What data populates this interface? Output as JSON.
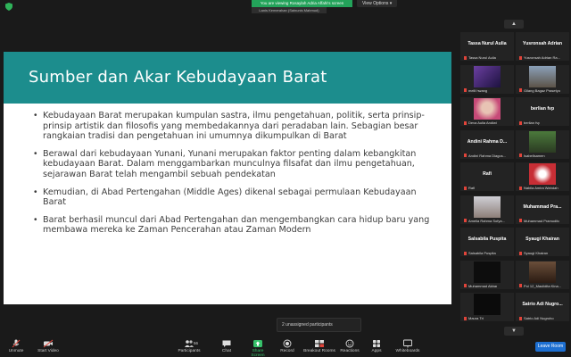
{
  "banner": {
    "viewing_text": "You are viewing Rosaylah Adria Affahi's screen",
    "sub_text": "Lanis Kemerahan (Sainunis Mahmud)",
    "view_options": "View Options"
  },
  "slide": {
    "title": "Sumber dan Akar Kebudayaan Barat",
    "bullets": [
      "Kebudayaan Barat merupakan kumpulan sastra, ilmu pengetahuan, politik, serta prinsip-prinsip artistik dan filosofis yang membedakannya dari peradaban lain. Sebagian besar rangkaian tradisi dan pengetahuan ini umumnya dikumpulkan di Barat",
      "Berawal dari kebudayaan Yunani, Yunani merupakan faktor penting dalam kebangkitan kebudayaan Barat. Dalam menggambarkan munculnya filsafat dan ilmu pengetahuan, sejarawan Barat telah mengambil sebuah pendekatan",
      "Kemudian, di Abad Pertengahan (Middle Ages) dikenal sebagai permulaan Kebudayaan Barat",
      "Barat berhasil muncul dari Abad Pertengahan dan mengembangkan cara hidup baru yang membawa mereka ke Zaman Pencerahan atau Zaman Modern"
    ]
  },
  "popup": {
    "text": "2 unassigned participants"
  },
  "participants": [
    {
      "big": "Tassa Nurul Aulia",
      "small": "Tassa Nurul Aulia",
      "photo": ""
    },
    {
      "big": "Yusronsah Adrian",
      "small": "Yusronsah Adrian Ra...",
      "photo": ""
    },
    {
      "big": "",
      "small": "melli hwang",
      "photo": "purple"
    },
    {
      "big": "",
      "small": "Gilang Bagaz Prasetyo",
      "photo": "street"
    },
    {
      "big": "",
      "small": "Deva Aulia Andiwi",
      "photo": "face"
    },
    {
      "big": "berlian fvp",
      "small": "berlian fvp",
      "photo": ""
    },
    {
      "big": "Andini Rahma D...",
      "small": "Andini Rahma Diagos...",
      "photo": ""
    },
    {
      "big": "",
      "small": "Isabellsamen",
      "photo": "green"
    },
    {
      "big": "Rafi",
      "small": "Rafi",
      "photo": ""
    },
    {
      "big": "",
      "small": "Nabila Amira Wahdah",
      "photo": "red"
    },
    {
      "big": "",
      "small": "Amelia Rahma Sofya...",
      "photo": "room"
    },
    {
      "big": "Muhammad Pra...",
      "small": "Muhammad Pramudito",
      "photo": ""
    },
    {
      "big": "Salsabila Puspita",
      "small": "Salsabila Puspita",
      "photo": ""
    },
    {
      "big": "Syaugi Khairan",
      "small": "Syaugi Khairan",
      "photo": ""
    },
    {
      "big": "",
      "small": "Muhammad Akbar",
      "photo": "dark"
    },
    {
      "big": "",
      "small": "Pol 12_Maulidita Kina...",
      "photo": "brown"
    },
    {
      "big": "",
      "small": "Maura Tri",
      "photo": "dark2"
    },
    {
      "big": "Satrio Adi Nugro...",
      "small": "Satrio Adi Nugroho",
      "photo": ""
    }
  ],
  "toolbar": {
    "unmute": "Unmute",
    "start_video": "Start Video",
    "participants": "Participants",
    "participants_count": "56",
    "chat": "Chat",
    "share_screen": "Share Screen",
    "record": "Record",
    "breakout_rooms": "Breakout Rooms",
    "reactions": "Reactions",
    "apps": "Apps",
    "whiteboards": "Whiteboards",
    "leave": "Leave Room"
  },
  "colors": {
    "slide_header": "#1c8d8d",
    "share_green": "#36c16a",
    "leave_blue": "#1d6fd1",
    "banner_green": "#23a35a"
  }
}
